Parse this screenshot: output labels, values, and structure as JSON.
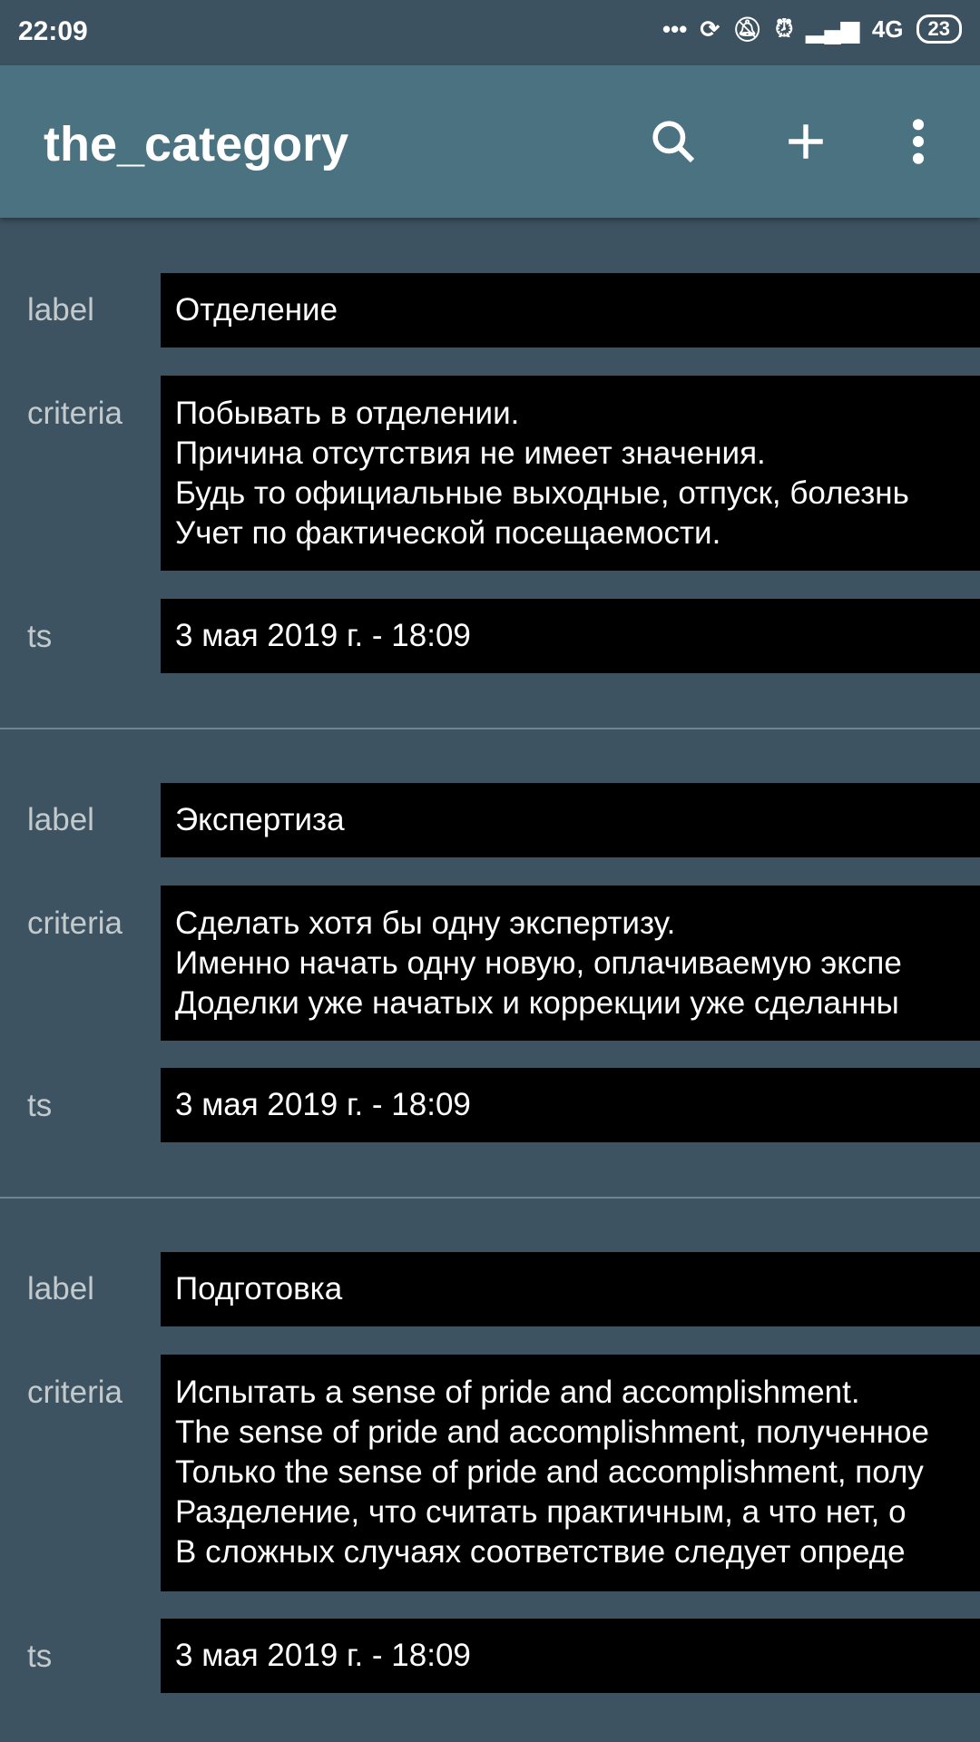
{
  "status_bar": {
    "time": "22:09",
    "network": "4G",
    "battery": "23"
  },
  "app_bar": {
    "title": "the_category",
    "actions": [
      "search-icon",
      "add-icon",
      "more-vert-icon"
    ]
  },
  "colors": {
    "status_bar": "#3c5260",
    "app_bar": "#4a7280",
    "background": "#3d5361",
    "field_bg": "#000000"
  },
  "field_labels": {
    "label": "label",
    "criteria": "criteria",
    "ts": "ts"
  },
  "items": [
    {
      "label": "Отделение",
      "criteria": "Побывать в отделении.\nПричина отсутствия не имеет значения.\nБудь то официальные выходные, отпуск, болезнь\nУчет по фактической посещаемости.",
      "ts": "3 мая 2019 г. - 18:09"
    },
    {
      "label": "Экспертиза",
      "criteria": "Сделать хотя бы одну экспертизу.\nИменно начать одну новую, оплачиваемую экспе\nДоделки уже начатых и коррекции уже сделанны",
      "ts": "3 мая 2019 г. - 18:09"
    },
    {
      "label": "Подготовка",
      "criteria": "Испытать a sense of pride and accomplishment.\nThe sense of pride and accomplishment, полученное\nТолько the sense of pride and accomplishment, полу\nРазделение, что считать практичным, а что нет, о\nВ сложных случаях соответствие следует опреде",
      "ts": "3 мая 2019 г. - 18:09"
    }
  ]
}
